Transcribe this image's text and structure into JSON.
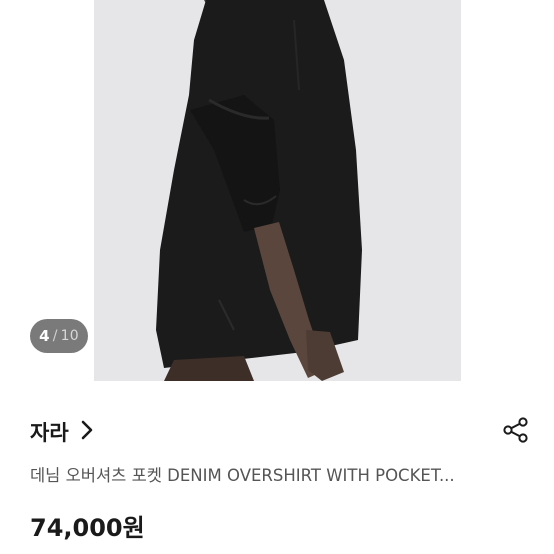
{
  "gallery": {
    "current_index": "4",
    "separator": "/",
    "total_count": "10",
    "photo_icon": "product-photo-black-denim-overshirt"
  },
  "shop": {
    "name": "자라",
    "chevron_icon": "chevron-right-icon",
    "share_icon": "share-icon"
  },
  "product": {
    "title": "데님 오버셔츠 포켓 DENIM OVERSHIRT WITH POCKET...",
    "price": "74,000원"
  },
  "colors": {
    "text_primary": "#1a1a1a",
    "text_secondary": "#555555",
    "counter_bg": "#3d3d3d"
  }
}
